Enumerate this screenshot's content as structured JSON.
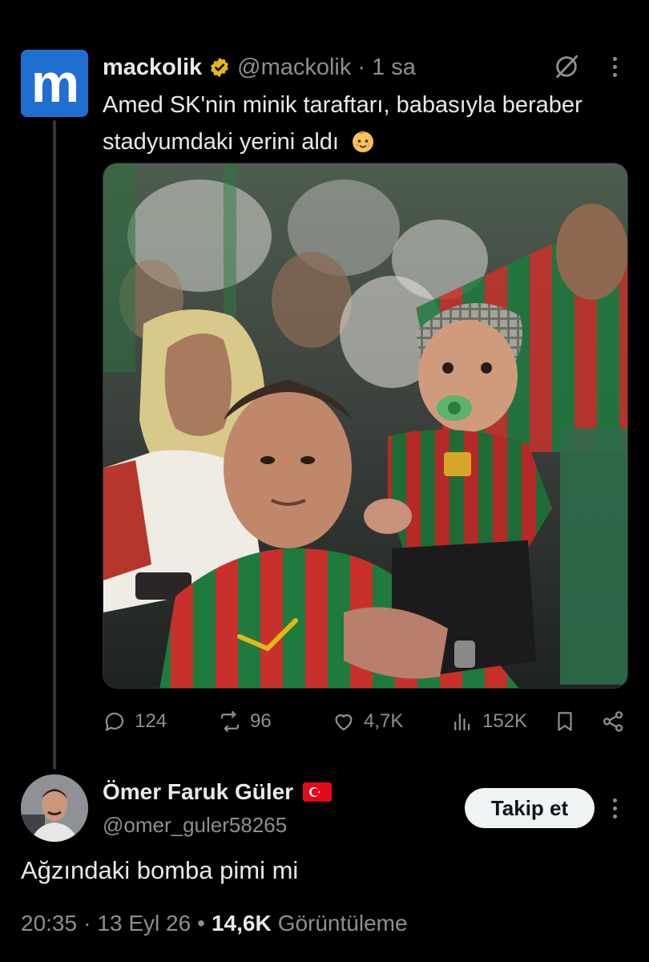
{
  "original_tweet": {
    "avatar_letter": "m",
    "author_name": "mackolik",
    "handle": "@mackolik",
    "separator": "·",
    "time": "1 sa",
    "text": "Amed SK'nin minik taraftarı, babasıyla beraber stadyumdaki yerini aldı",
    "emoji": "baby-face",
    "photo_alt": "photo",
    "stats": {
      "replies": "124",
      "reposts": "96",
      "likes": "4,7K",
      "views": "152K"
    }
  },
  "reply": {
    "author_name": "Ömer Faruk Güler",
    "flag": "turkey-flag",
    "handle": "@omer_guler58265",
    "follow_label": "Takip et",
    "text": "Ağzındaki bomba pimi mi",
    "time": "20:35",
    "date": "13 Eyl 26",
    "separator1": "·",
    "separator2": "•",
    "views_count": "14,6K",
    "views_label": "Görüntüleme"
  },
  "colors": {
    "background": "#000000",
    "muted_text": "#8b8f94",
    "primary_text": "#e7e9ea",
    "avatar_blue": "#1f6fd0",
    "verified_gold": "#e2b719",
    "follow_button_bg": "#eff3f4"
  }
}
